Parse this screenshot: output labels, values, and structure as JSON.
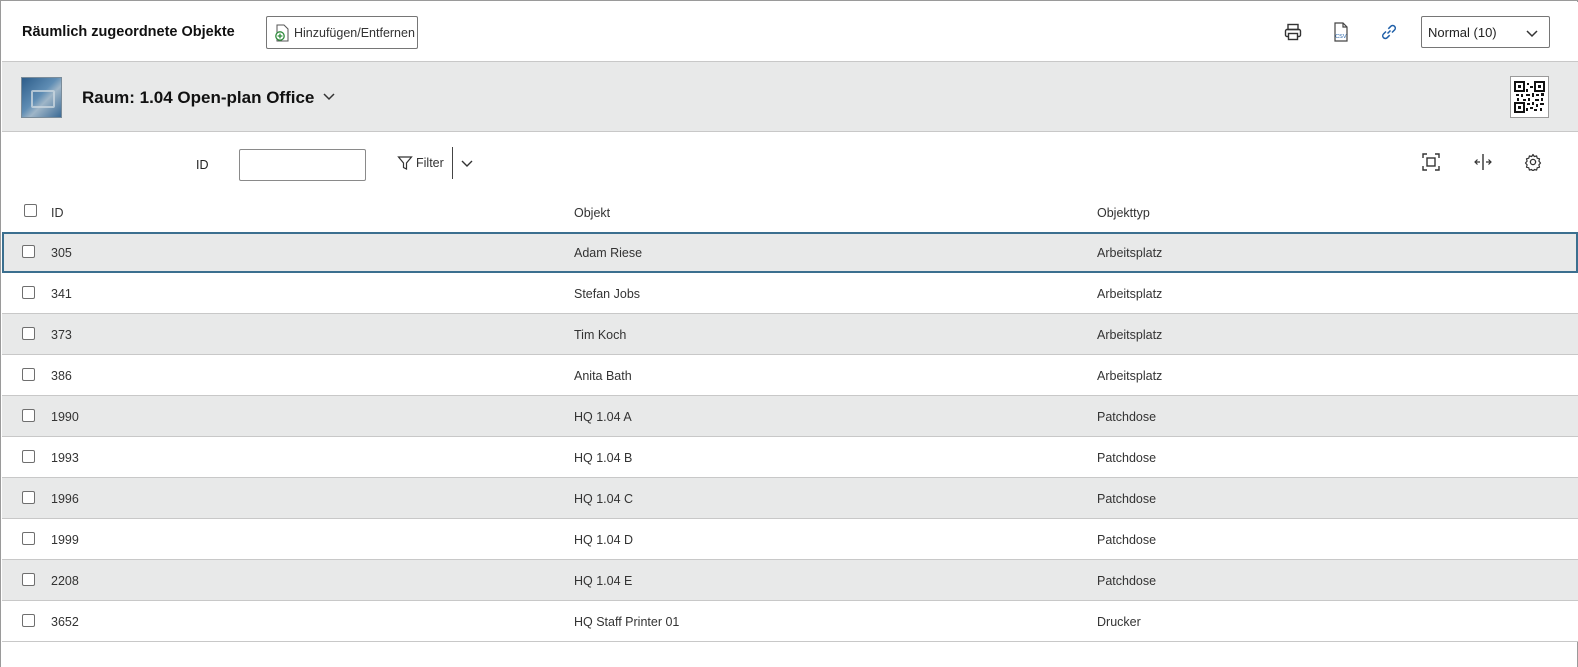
{
  "toolbar": {
    "title": "Räumlich zugeordnete Objekte",
    "add_remove_label": "Hinzufügen/Entfernen",
    "print_icon": "printer-icon",
    "csv_icon": "csv-export-icon",
    "csv_text": "CSV",
    "link_icon": "link-icon",
    "page_size_value": "Normal (10)"
  },
  "object": {
    "title": "Raum: 1.04 Open-plan Office",
    "qr_icon": "qr-code-icon"
  },
  "filter": {
    "id_label": "ID",
    "id_value": "",
    "filter_label": "Filter"
  },
  "table": {
    "headers": [
      "ID",
      "Objekt",
      "Objekttyp"
    ],
    "rows": [
      {
        "id": "305",
        "objekt": "Adam Riese",
        "typ": "Arbeitsplatz"
      },
      {
        "id": "341",
        "objekt": "Stefan Jobs",
        "typ": "Arbeitsplatz"
      },
      {
        "id": "373",
        "objekt": "Tim Koch",
        "typ": "Arbeitsplatz"
      },
      {
        "id": "386",
        "objekt": "Anita Bath",
        "typ": "Arbeitsplatz"
      },
      {
        "id": "1990",
        "objekt": "HQ 1.04 A",
        "typ": "Patchdose"
      },
      {
        "id": "1993",
        "objekt": "HQ 1.04 B",
        "typ": "Patchdose"
      },
      {
        "id": "1996",
        "objekt": "HQ 1.04 C",
        "typ": "Patchdose"
      },
      {
        "id": "1999",
        "objekt": "HQ 1.04 D",
        "typ": "Patchdose"
      },
      {
        "id": "2208",
        "objekt": "HQ 1.04 E",
        "typ": "Patchdose"
      },
      {
        "id": "3652",
        "objekt": "HQ Staff Printer 01",
        "typ": "Drucker"
      }
    ]
  },
  "colors": {
    "shade_row": "#e8e9e9",
    "focus_outline": "#3b6f8f",
    "link_blue": "#1f5fa8",
    "add_green": "#2e8b3a"
  }
}
